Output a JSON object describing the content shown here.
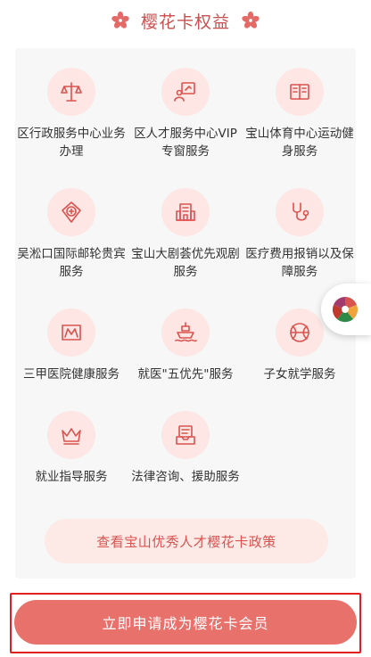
{
  "header": {
    "title": "樱花卡权益"
  },
  "colors": {
    "accent": "#d9534f",
    "icon_bg": "#fde6e4",
    "button": "#e8716b",
    "highlight_border": "#e02020"
  },
  "benefits": [
    {
      "label": "区行政服务中心业务办理",
      "icon": "scale-icon"
    },
    {
      "label": "区人才服务中心VIP专窗服务",
      "icon": "vip-window-icon"
    },
    {
      "label": "宝山体育中心运动健身服务",
      "icon": "book-icon"
    },
    {
      "label": "吴淞口国际邮轮贵宾服务",
      "icon": "cross-shield-icon"
    },
    {
      "label": "宝山大剧荟优先观剧服务",
      "icon": "theater-icon"
    },
    {
      "label": "医疗费用报销以及保障服务",
      "icon": "stethoscope-icon"
    },
    {
      "label": "三甲医院健康服务",
      "icon": "hospital-icon"
    },
    {
      "label": "就医\"五优先\"服务",
      "icon": "ship-icon"
    },
    {
      "label": "子女就学服务",
      "icon": "ball-icon"
    },
    {
      "label": "就业指导服务",
      "icon": "crown-icon"
    },
    {
      "label": "法律咨询、援助服务",
      "icon": "inbox-icon"
    }
  ],
  "policy_button": {
    "label": "查看宝山优秀人才樱花卡政策"
  },
  "apply_button": {
    "label": "立即申请成为樱花卡会员"
  }
}
